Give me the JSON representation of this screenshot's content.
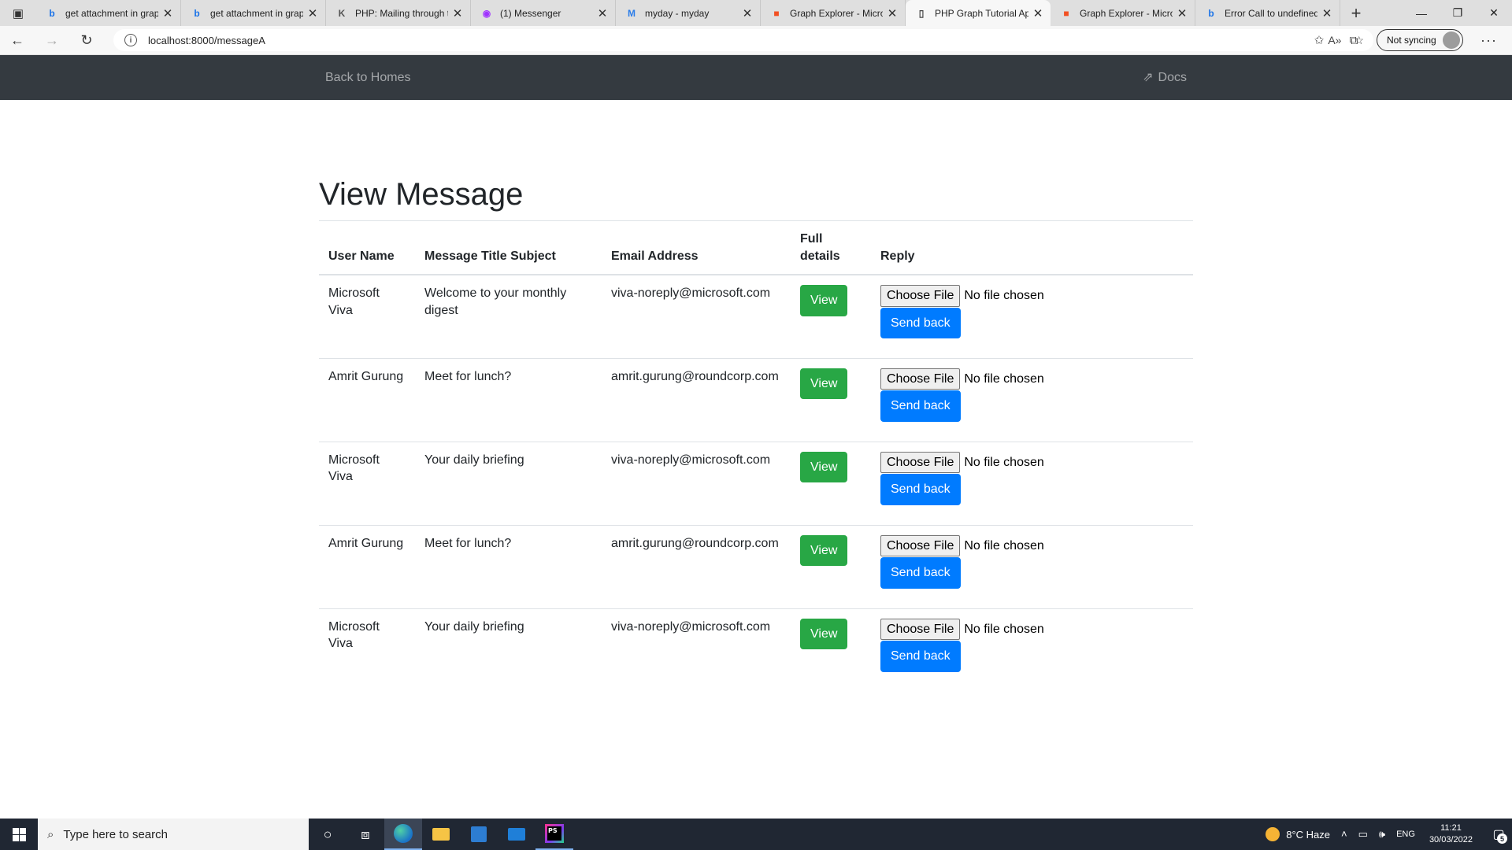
{
  "browser": {
    "tabs": [
      {
        "title": "get attachment in graph",
        "favicon": "bing-icon",
        "color": "#1a73e8",
        "glyph": "b"
      },
      {
        "title": "get attachment in graph",
        "favicon": "bing-icon",
        "color": "#1a73e8",
        "glyph": "b"
      },
      {
        "title": "PHP: Mailing through the",
        "favicon": "kd-icon",
        "color": "#555555",
        "glyph": "K"
      },
      {
        "title": "(1) Messenger",
        "favicon": "messenger-icon",
        "color": "#a033ff",
        "glyph": "◉"
      },
      {
        "title": "myday - myday",
        "favicon": "myday-icon",
        "color": "#2b7de9",
        "glyph": "M"
      },
      {
        "title": "Graph Explorer - Microsoft",
        "favicon": "microsoft-icon",
        "color": "#f25022",
        "glyph": "■"
      },
      {
        "title": "PHP Graph Tutorial App",
        "favicon": "page-icon",
        "color": "#444444",
        "glyph": "▯",
        "active": true
      },
      {
        "title": "Graph Explorer - Microsoft",
        "favicon": "microsoft-icon",
        "color": "#f25022",
        "glyph": "■"
      },
      {
        "title": "Error Call to undefined",
        "favicon": "bing-icon",
        "color": "#1a73e8",
        "glyph": "b"
      }
    ],
    "url": "localhost:8000/messageA",
    "sync_label": "Not syncing"
  },
  "navbar": {
    "home_link": "Back to Homes",
    "docs_link": "Docs"
  },
  "page": {
    "title": "View Message",
    "columns": [
      "User Name",
      "Message Title Subject",
      "Email Address",
      "Full details",
      "Reply"
    ],
    "rows": [
      {
        "user": "Microsoft Viva",
        "subject": "Welcome to your monthly digest",
        "email": "viva-noreply@microsoft.com"
      },
      {
        "user": "Amrit Gurung",
        "subject": "Meet for lunch?",
        "email": "amrit.gurung@roundcorp.com"
      },
      {
        "user": "Microsoft Viva",
        "subject": "Your daily briefing",
        "email": "viva-noreply@microsoft.com"
      },
      {
        "user": "Amrit Gurung",
        "subject": "Meet for lunch?",
        "email": "amrit.gurung@roundcorp.com"
      },
      {
        "user": "Microsoft Viva",
        "subject": "Your daily briefing",
        "email": "viva-noreply@microsoft.com"
      }
    ],
    "view_label": "View",
    "choose_file_label": "Choose File",
    "no_file_label": "No file chosen",
    "send_label": "Send back"
  },
  "taskbar": {
    "search_placeholder": "Type here to search",
    "weather": "8°C  Haze",
    "language": "ENG",
    "time": "11:21",
    "date": "30/03/2022",
    "notifications": "5"
  }
}
